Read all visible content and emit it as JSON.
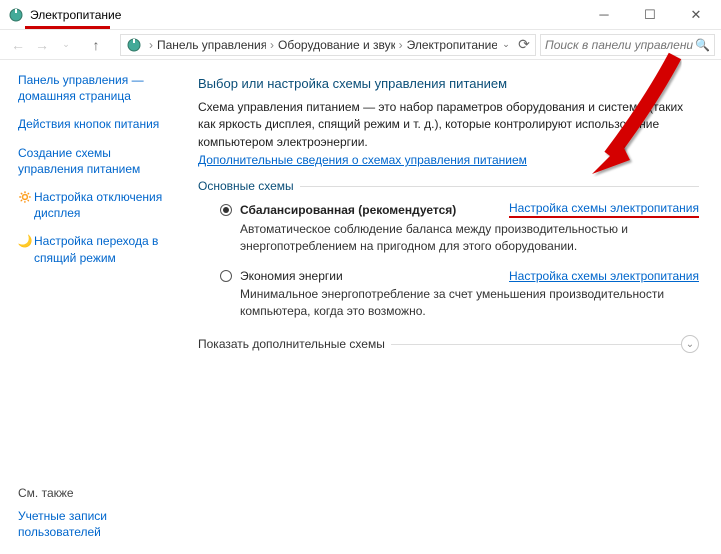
{
  "window": {
    "title": "Электропитание"
  },
  "nav": {
    "breadcrumb": [
      "Панель управления",
      "Оборудование и звук",
      "Электропитание"
    ],
    "search_placeholder": "Поиск в панели управления"
  },
  "sidebar": {
    "links": [
      "Панель управления — домашняя страница",
      "Действия кнопок питания",
      "Создание схемы управления питанием",
      "Настройка отключения дисплея",
      "Настройка перехода в спящий режим"
    ],
    "see_also_label": "См. также",
    "see_also_links": [
      "Учетные записи пользователей"
    ]
  },
  "main": {
    "heading": "Выбор или настройка схемы управления питанием",
    "desc": "Схема управления питанием — это набор параметров оборудования и системы (таких как яркость дисплея, спящий режим и т. д.), которые контролируют использование компьютером электроэнергии.",
    "more_link": "Дополнительные сведения о схемах управления питанием",
    "section_title": "Основные схемы",
    "plans": [
      {
        "name": "Сбалансированная (рекомендуется)",
        "selected": true,
        "config_link": "Настройка схемы электропитания",
        "description": "Автоматическое соблюдение баланса между производительностью и энергопотреблением на пригодном для этого оборудовании."
      },
      {
        "name": "Экономия энергии",
        "selected": false,
        "config_link": "Настройка схемы электропитания",
        "description": "Минимальное энергопотребление за счет уменьшения производительности компьютера, когда это возможно."
      }
    ],
    "show_more": "Показать дополнительные схемы"
  }
}
